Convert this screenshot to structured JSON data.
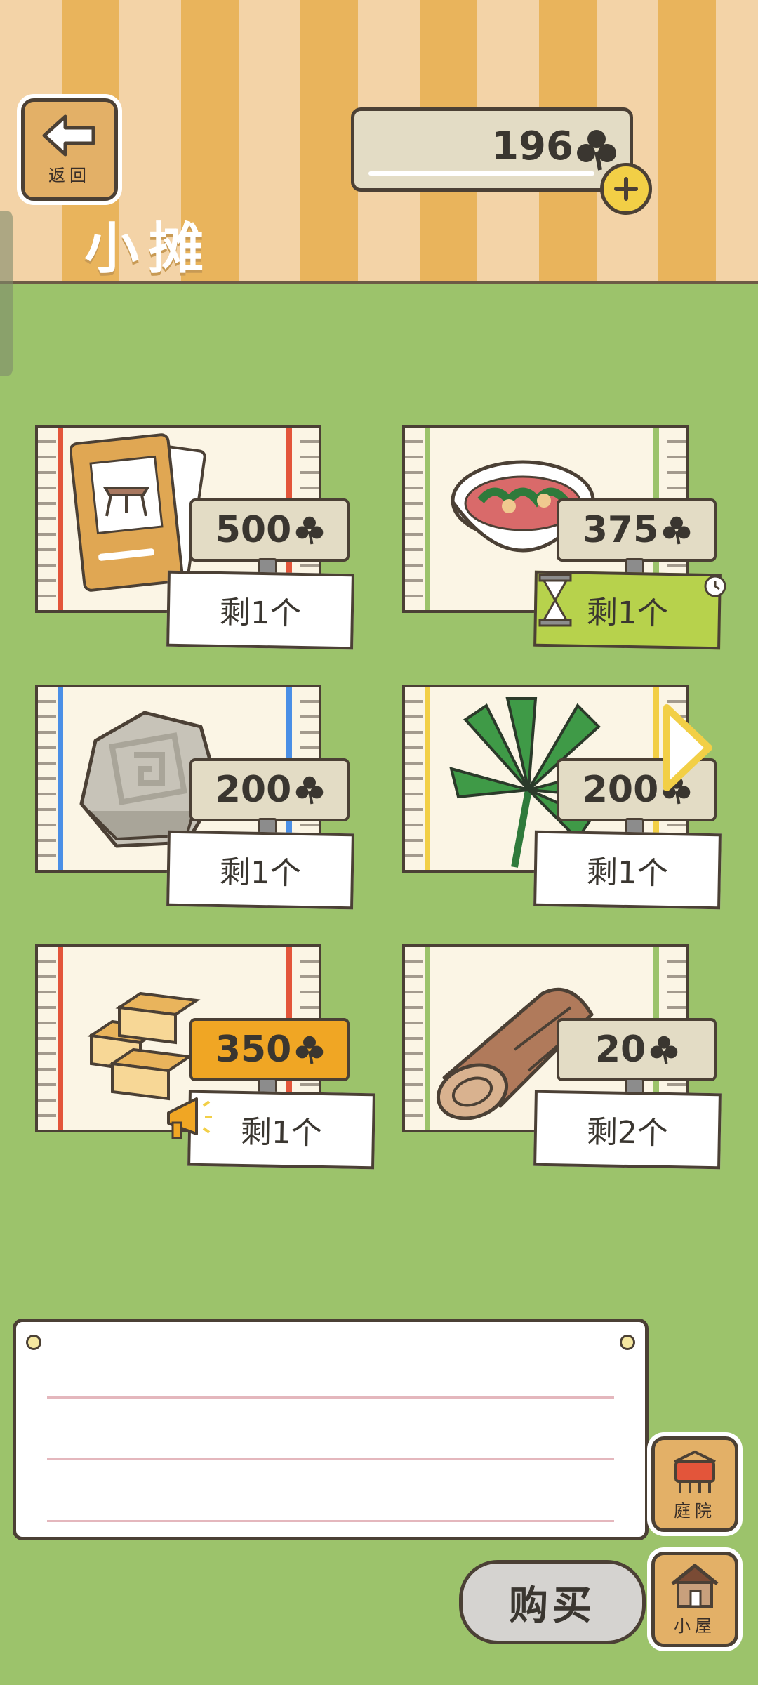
{
  "header": {
    "back_label": "返回",
    "title": "小摊",
    "currency_value": "196",
    "currency_icon": "clover-icon",
    "add_icon": "plus-icon"
  },
  "items": [
    {
      "name": "folding-table-catalog",
      "price": "500",
      "stock": "剩1个",
      "stripe": "#e3553a",
      "special": ""
    },
    {
      "name": "salad-bowl",
      "price": "375",
      "stock": "剩1个",
      "stripe": "#9cc36b",
      "special": "timed"
    },
    {
      "name": "spiral-stone",
      "price": "200",
      "stock": "剩1个",
      "stripe": "#4a8fe6",
      "special": ""
    },
    {
      "name": "palm-leaf",
      "price": "200",
      "stock": "剩1个",
      "stripe": "#f2cf46",
      "special": ""
    },
    {
      "name": "castella-cake",
      "price": "350",
      "stock": "剩1个",
      "stripe": "#e3553a",
      "special": "hot"
    },
    {
      "name": "wood-log",
      "price": "20",
      "stock": "剩2个",
      "stripe": "#9cc36b",
      "special": ""
    }
  ],
  "nav": {
    "yard_label": "庭院",
    "house_label": "小屋",
    "buy_label": "购买"
  },
  "colors": {
    "grass": "#9cc36b",
    "outline": "#4b4035",
    "hot_price": "#f0a624",
    "timed_stock": "#b7d24c"
  }
}
